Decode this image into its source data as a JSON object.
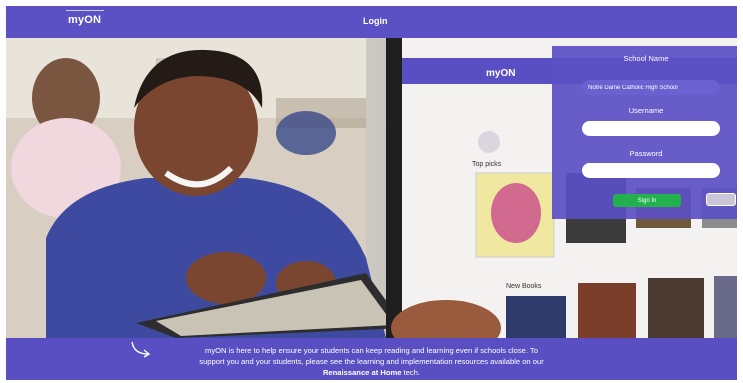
{
  "header": {
    "logo": "myON",
    "login_link": "Login"
  },
  "login_panel": {
    "school_label": "School Name",
    "school_value": "Notre Dame Catholic High School",
    "username_label": "Username",
    "password_label": "Password",
    "signin_label": "Sign In"
  },
  "tablet": {
    "top_picks_label": "Top picks",
    "new_books_label": "New Books"
  },
  "footer": {
    "line1": "myON is here to help ensure your students can keep reading and learning even if schools close. To",
    "line2": "support you and your students, please see the learning and implementation resources available on our",
    "link": "Renaissance at Home",
    "line3_suffix": " tech."
  },
  "colors": {
    "brand": "#5a4fc2",
    "signin": "#23b14d"
  }
}
